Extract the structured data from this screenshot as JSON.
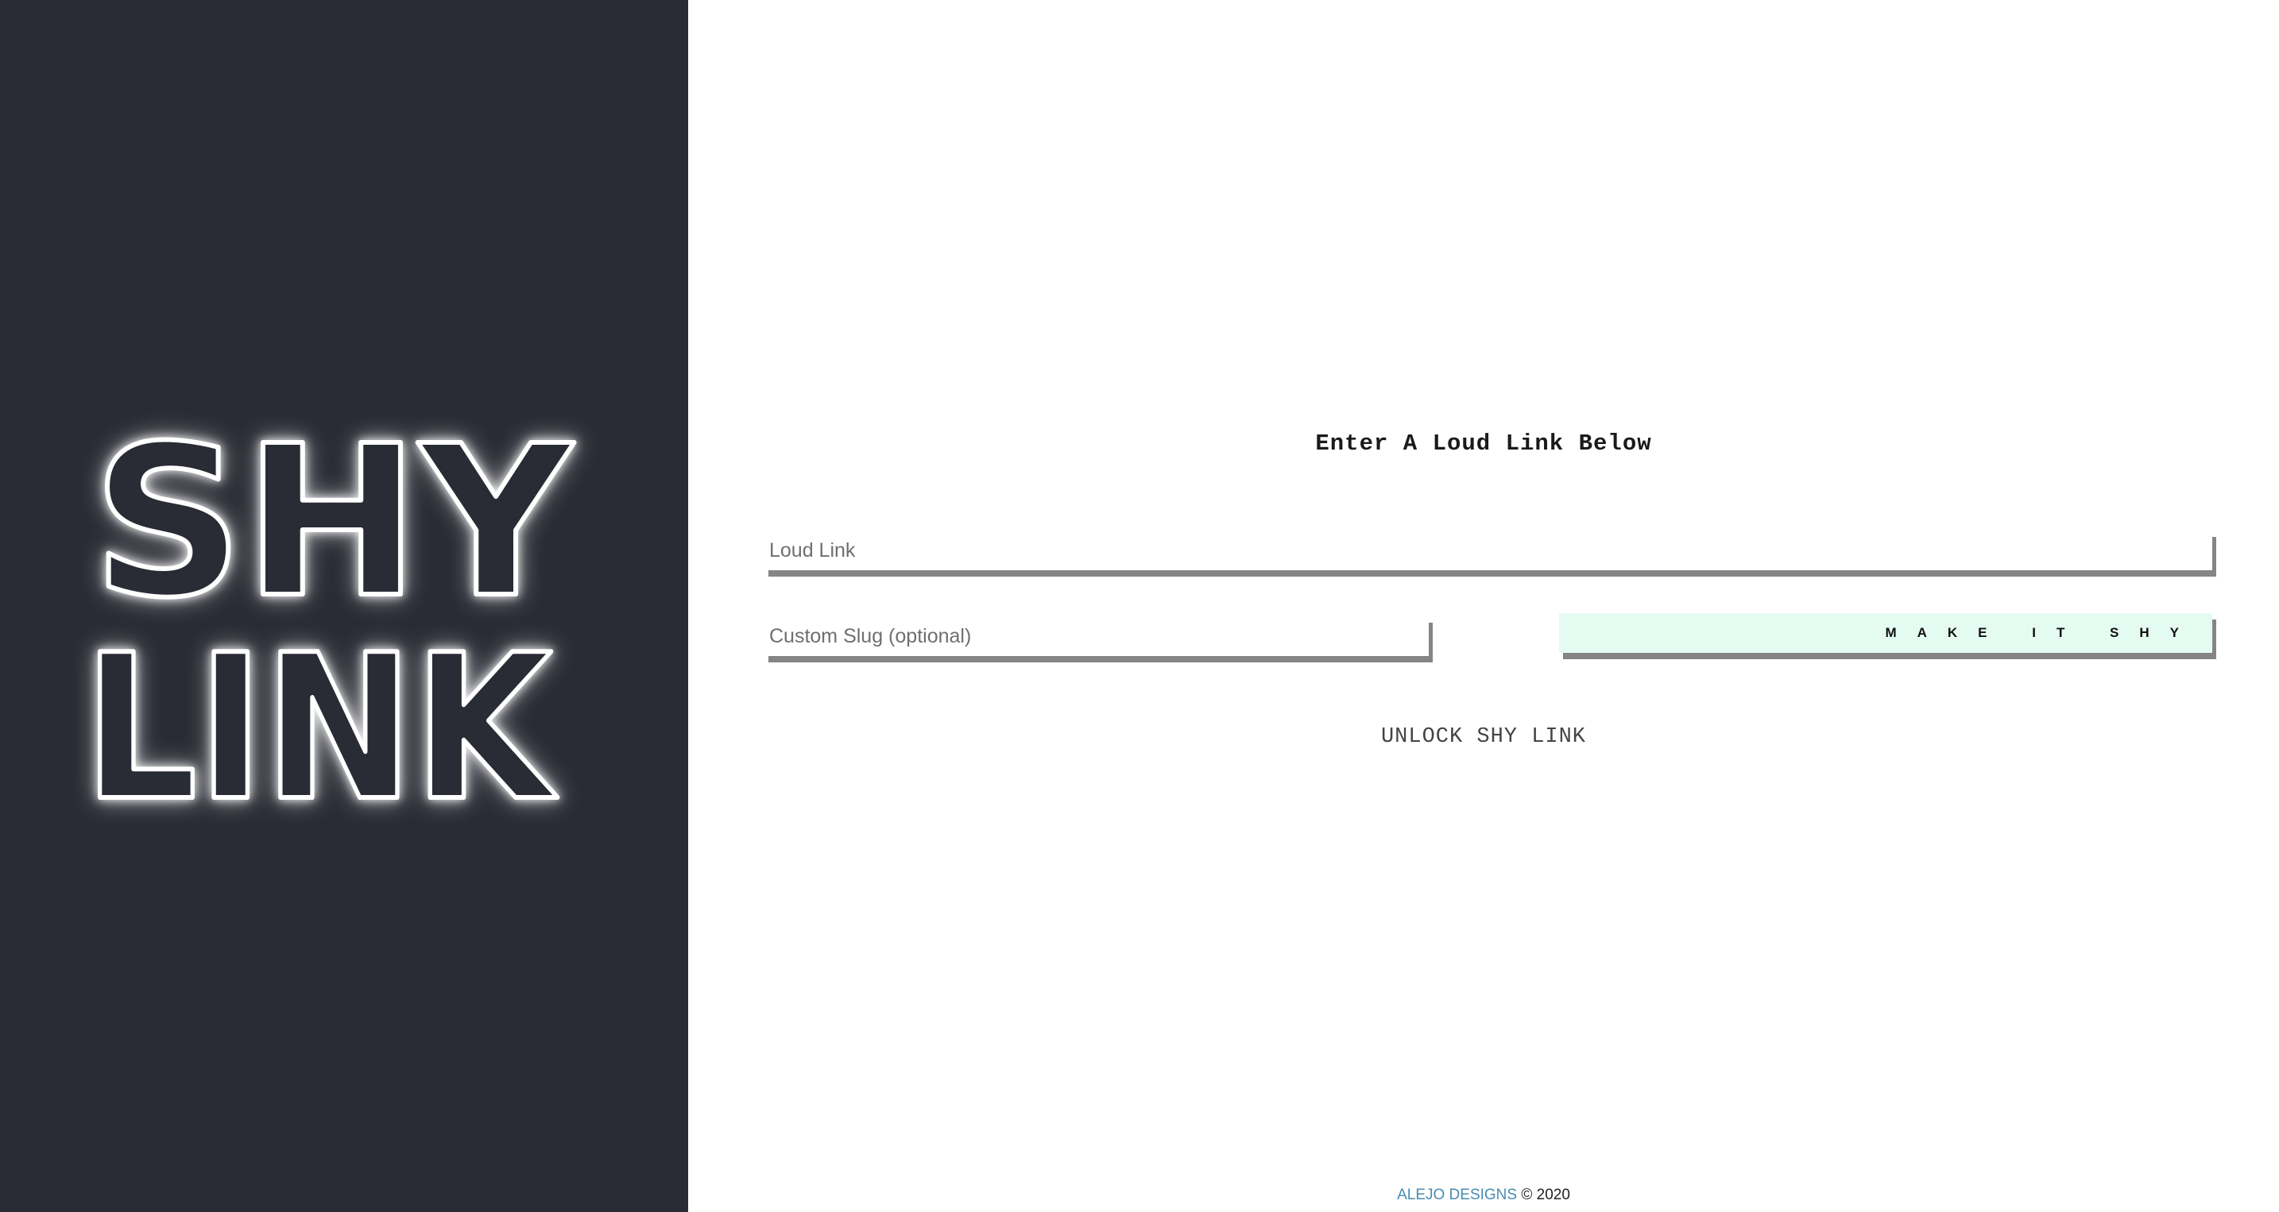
{
  "logo": {
    "line1": "SHY",
    "line2": "LINK"
  },
  "form": {
    "heading": "Enter A Loud Link Below",
    "loud_link_placeholder": "Loud Link",
    "slug_placeholder": "Custom Slug (optional)",
    "submit_label": "MAKE IT SHY",
    "unlock_label": "UNLOCK SHY LINK"
  },
  "footer": {
    "brand": "ALEJO DESIGNS",
    "copyright": "© 2020"
  },
  "colors": {
    "sidebar_bg": "#292c34",
    "button_bg": "#e4fbf2",
    "link_color": "#4a8bb0",
    "shadow": "#858585"
  }
}
